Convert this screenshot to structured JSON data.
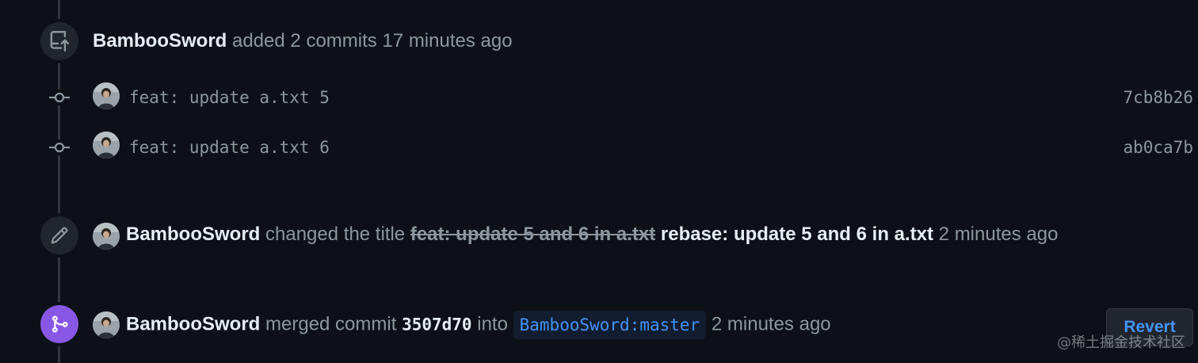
{
  "colors": {
    "background": "#0d1117",
    "timeline": "#30363d",
    "badge": "#21262d",
    "merged_badge": "#8957e5",
    "link": "#4493f8",
    "text_primary": "#e6edf3",
    "text_muted": "#8d96a0"
  },
  "push_event": {
    "icon": "repo-push-icon",
    "actor": "BambooSword",
    "action": "added 2 commits",
    "time": "17 minutes ago",
    "commits": [
      {
        "message": "feat: update a.txt 5",
        "sha": "7cb8b26"
      },
      {
        "message": "feat: update a.txt 6",
        "sha": "ab0ca7b"
      }
    ]
  },
  "rename_event": {
    "icon": "pencil-icon",
    "actor": "BambooSword",
    "action": "changed the title",
    "old_title": "feat: update 5 and 6 in a.txt",
    "new_title": "rebase: update 5 and 6 in a.txt",
    "time": "2 minutes ago"
  },
  "merge_event": {
    "icon": "git-merge-icon",
    "actor": "BambooSword",
    "action": "merged commit",
    "commit": "3507d70",
    "into": "into",
    "branch": "BambooSword:master",
    "time": "2 minutes ago",
    "revert_label": "Revert"
  },
  "watermark": "@稀土掘金技术社区"
}
